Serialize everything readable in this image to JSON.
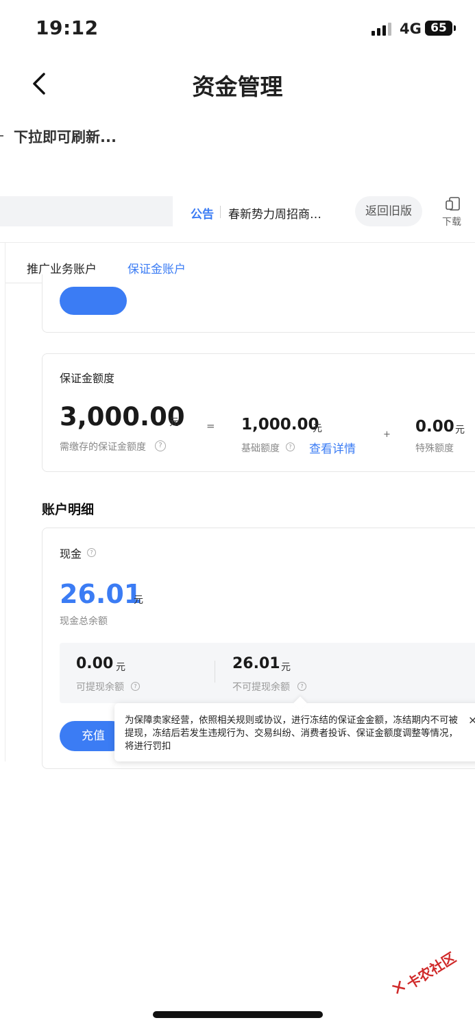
{
  "status_bar": {
    "time": "19:12",
    "network": "4G",
    "battery": "65"
  },
  "nav": {
    "title": "资金管理"
  },
  "refresh_hint": "下拉即可刷新...",
  "notice": {
    "label": "公告",
    "text": "春新势力周招商…"
  },
  "buttons": {
    "old_version": "返回旧版",
    "download": "下载",
    "recharge": "充值"
  },
  "tabs": [
    {
      "label": "推广业务账户",
      "active": false
    },
    {
      "label": "保证金账户",
      "active": true
    }
  ],
  "deposit": {
    "title": "保证金额度",
    "total": "3,000.00",
    "unit": "元",
    "total_label": "需缴存的保证金额度",
    "equals": "=",
    "base": "1,000.00",
    "base_label": "基础额度",
    "detail_link": "查看详情",
    "plus": "+",
    "special": "0.00",
    "special_label": "特殊额度"
  },
  "account_detail": {
    "title": "账户明细",
    "cash_label": "现金",
    "cash_total": "26.01",
    "unit": "元",
    "cash_total_label": "现金总余额",
    "withdrawable": "0.00",
    "withdrawable_label": "可提现余额",
    "non_withdrawable": "26.01",
    "non_withdrawable_label": "不可提现余额"
  },
  "tooltip": {
    "text": "为保障卖家经营，依照相关规则或协议，进行冻结的保证金金额，冻结期内不可被提现，冻结后若发生违规行为、交易纠纷、消费者投诉、保证金额度调整等情况，将进行罚扣",
    "close": "×"
  },
  "watermark": "卡农社区",
  "colors": {
    "accent": "#3b7cf4",
    "text": "#1f1f1f",
    "muted": "#888888"
  }
}
